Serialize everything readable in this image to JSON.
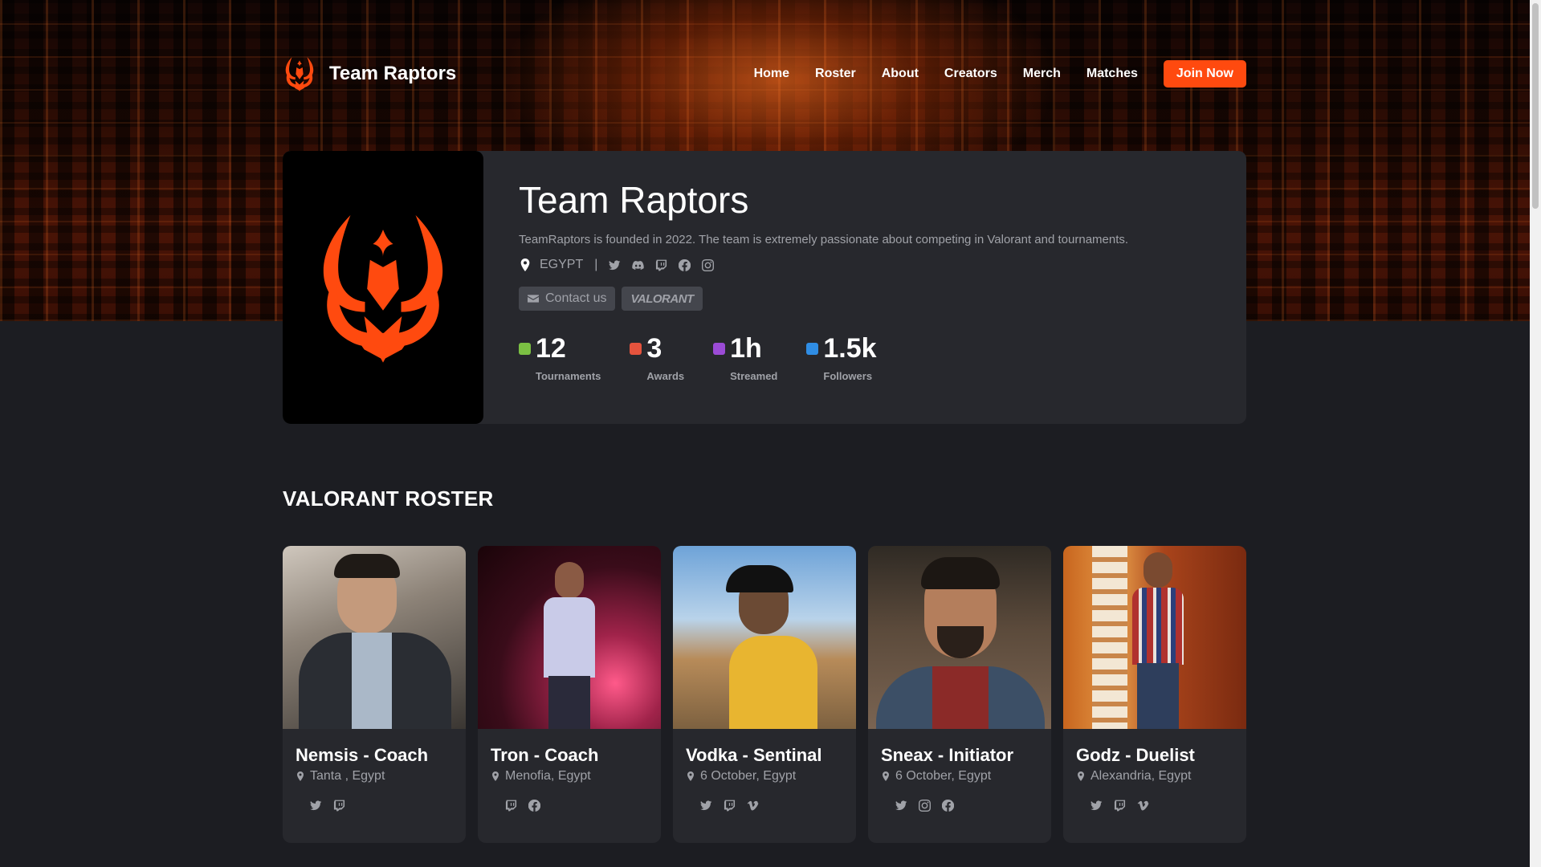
{
  "brand": {
    "name": "Team Raptors"
  },
  "nav": {
    "links": [
      "Home",
      "Roster",
      "About",
      "Creators",
      "Merch",
      "Matches"
    ],
    "cta": "Join Now"
  },
  "profile": {
    "title": "Team Raptors",
    "description": "TeamRaptors is founded in 2022. The team is extremely passionate about competing in Valorant and tournaments.",
    "country": "EGYPT",
    "separator": "|",
    "contact_label": "Contact us",
    "game_badge": "VALORANT",
    "stats": [
      {
        "value": "12",
        "label": "Tournaments",
        "color": "#7bc043"
      },
      {
        "value": "3",
        "label": "Awards",
        "color": "#e5533d"
      },
      {
        "value": "1h",
        "label": "Streamed",
        "color": "#9b4bd6"
      },
      {
        "value": "1.5k",
        "label": "Followers",
        "color": "#2f8de4"
      }
    ]
  },
  "roster": {
    "title": "VALORANT ROSTER",
    "players": [
      {
        "name": "Nemsis - Coach",
        "location": "Tanta , Egypt"
      },
      {
        "name": "Tron - Coach",
        "location": "Menofia, Egypt"
      },
      {
        "name": "Vodka - Sentinal",
        "location": "6 October, Egypt"
      },
      {
        "name": "Sneax - Initiator",
        "location": "6 October, Egypt"
      },
      {
        "name": "Godz - Duelist",
        "location": "Alexandria, Egypt"
      }
    ]
  },
  "colors": {
    "accent": "#ff4a0f",
    "card": "#27282d",
    "page": "#1c1d22"
  }
}
